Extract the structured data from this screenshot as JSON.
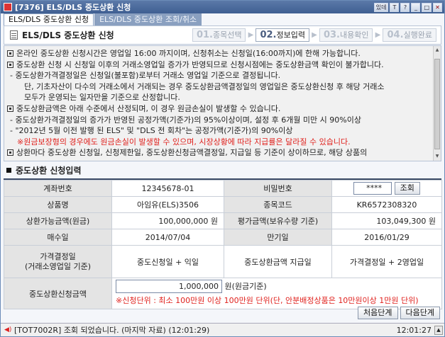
{
  "window": {
    "title": "[7376] ELS/DLS 중도상환 신청",
    "title_buttons": [
      "있데",
      "T",
      "?",
      "_",
      "□",
      "✕"
    ]
  },
  "tabs": [
    {
      "label": "ELS/DLS 중도상환 신청",
      "active": true
    },
    {
      "label": "ELS/DLS 중도상환 조회/취소",
      "active": false
    }
  ],
  "header": {
    "title": "ELS/DLS 중도상환 신청",
    "steps": [
      {
        "num": "01.",
        "label": "종목선택",
        "active": false
      },
      {
        "num": "02.",
        "label": "정보입력",
        "active": true
      },
      {
        "num": "03.",
        "label": "내용확인",
        "active": false
      },
      {
        "num": "04.",
        "label": "실행완료",
        "active": false
      }
    ]
  },
  "notice": {
    "lines": [
      {
        "text": "온라인 중도상환 신청시간은 영업일 16:00 까지이며, 신청취소는 신청일(16:00까지)에 한해 가능합니다.",
        "bullet": true,
        "style": "normal"
      },
      {
        "text": "중도상환 신청 시 신청일 이후의 거래소영업일 증가가 반영되므로 신청시점에는 중도상환금액 확인이 불가합니다.",
        "bullet": true,
        "style": "normal"
      },
      {
        "text": "- 중도상환가격결정일은 신청일(불포함)로부터 거래소 영업일 기준으로 결정됩니다.",
        "bullet": false,
        "style": "ind1"
      },
      {
        "text": "단, 기초자산이 다수의 거래소에서 거래되는 경우 중도상환금액결정일의 영업일은 중도상환신청 후 해당 거래소",
        "bullet": false,
        "style": "ind2"
      },
      {
        "text": "모두가 운영되는 일자만을 기준으로 산정합니다.",
        "bullet": false,
        "style": "ind2"
      },
      {
        "text": "중도상환금액은 아래 수준에서 산정되며, 이 경우 원금손실이 발생할 수 있습니다.",
        "bullet": true,
        "style": "normal"
      },
      {
        "text": "- 중도상환가격결정일의 증가가 반영된 공정가액(기준가)의 95%이상이며, 설정 후 6개월 미만 시 90%이상",
        "bullet": false,
        "style": "ind1"
      },
      {
        "text": "- \"2012년 5월 이전 발행 된 ELS\" 및 \"DLS 전 회차\"는 공정가액(기준가)의 90%이상",
        "bullet": false,
        "style": "ind1"
      },
      {
        "text": "※원금보장형의 경우에도 원금손실이 발생할 수 있으며, 시장상황에 따라 지급률은 달라질 수 있습니다.",
        "bullet": false,
        "style": "red"
      },
      {
        "text": "상환마다 중도상환 신청일, 신청제한일, 중도상환신청금액결정일, 지급일 등 기준이 상이하므로, 해당 상품의",
        "bullet": true,
        "style": "normal"
      }
    ]
  },
  "section": {
    "title": "중도상환 신청입력"
  },
  "form": {
    "account_label": "계좌번호",
    "account_value": "12345678-01",
    "password_label": "비밀번호",
    "password_value": "****",
    "inquiry_button": "조회",
    "product_label": "상품명",
    "product_value": "아임유(ELS)3506",
    "code_label": "종목코드",
    "code_value": "KR6572308320",
    "redeemable_label": "상환가능금액(원금)",
    "redeemable_value": "100,000,000",
    "redeemable_unit": "원",
    "eval_label": "평가금액(보유수량 기준)",
    "eval_value": "103,049,300",
    "eval_unit": "원",
    "buy_date_label": "매수일",
    "buy_date_value": "2014/07/04",
    "maturity_label": "만기일",
    "maturity_value": "2016/01/29",
    "price_date_label": "가격결정일",
    "price_date_sub": "(거래소영업일 기준)",
    "price_date_value": "중도신청일 + 익일",
    "pay_date_label": "중도상환금액 지급일",
    "pay_date_value": "가격결정일 + 2영업일",
    "amount_label": "중도상환신청금액",
    "amount_value": "1,000,000",
    "amount_unit": "원(원금기준)",
    "amount_note": "※신청단위 : 최소 100만원 이상 100만원 단위(단, 안분배정상품은 10만원이상 1만원 단위)"
  },
  "buttons": {
    "first_step": "처음단계",
    "next_step": "다음단계"
  },
  "status": {
    "message": "[TOT7002R] 조회 되었습니다. (마지막 자료) (12:01:29)",
    "time": "12:01:27"
  },
  "colors": {
    "titlebar": "#3f5f92",
    "warning_red": "#e0221e",
    "label_bg": "#e4e4e4"
  }
}
